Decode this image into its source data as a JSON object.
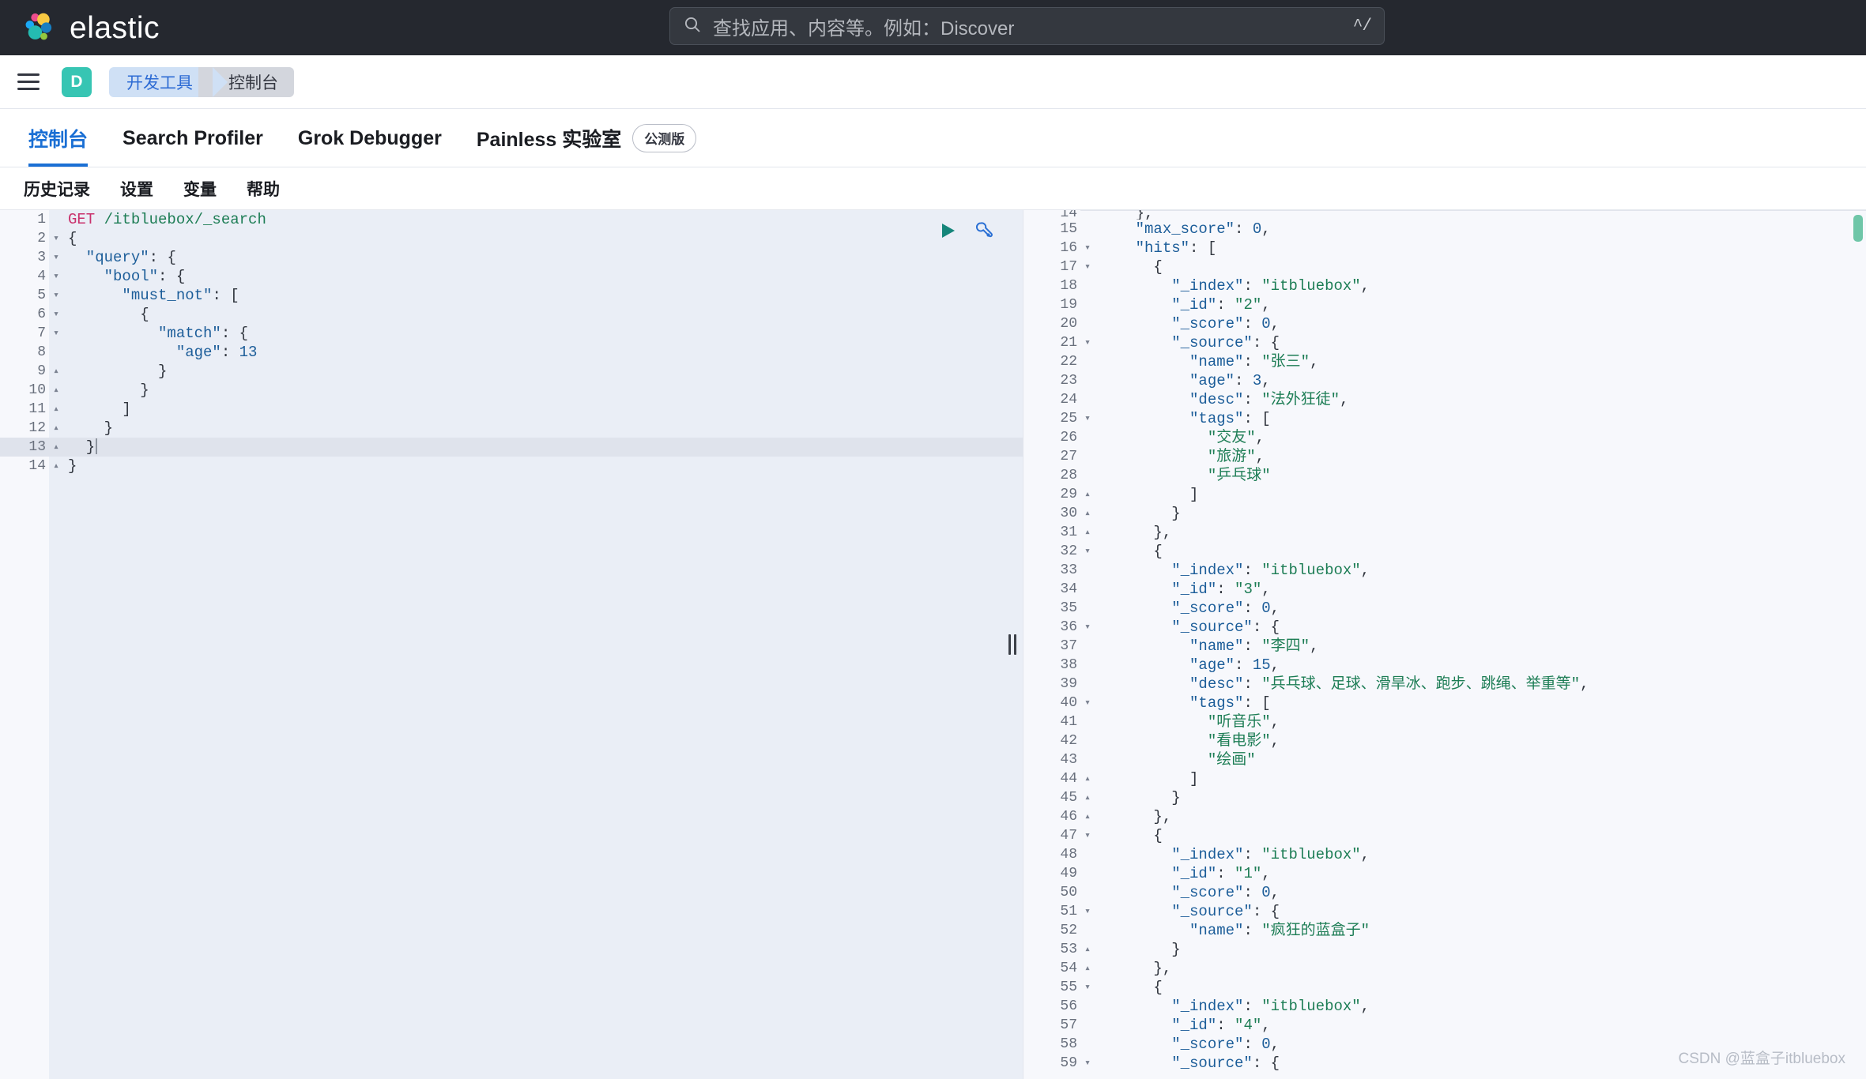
{
  "header": {
    "brand": "elastic",
    "logo_icon": "elastic-logo-icon",
    "search": {
      "icon": "search-icon",
      "placeholder": "查找应用、内容等。例如：Discover",
      "shortcut": "^/"
    }
  },
  "breadcrumb_bar": {
    "menu_icon": "hamburger-menu-icon",
    "space_avatar": "D",
    "crumbs": [
      {
        "label": "开发工具"
      },
      {
        "label": "控制台"
      }
    ]
  },
  "tabs": [
    {
      "label": "控制台",
      "active": true
    },
    {
      "label": "Search Profiler",
      "active": false
    },
    {
      "label": "Grok Debugger",
      "active": false
    },
    {
      "label": "Painless 实验室",
      "active": false,
      "badge": "公测版"
    }
  ],
  "console_menu": [
    {
      "label": "历史记录"
    },
    {
      "label": "设置"
    },
    {
      "label": "变量"
    },
    {
      "label": "帮助"
    }
  ],
  "editor_actions": {
    "play": "play-icon",
    "wrench": "wrench-icon"
  },
  "colors": {
    "accent_blue": "#1a6fd4",
    "brand_teal": "#37c5b3",
    "method": "#c9316c",
    "string": "#1d7d55",
    "key": "#1c5d99",
    "scroll_indicator": "#6fc6a8"
  },
  "request_editor": {
    "active_line": 13,
    "lines": [
      {
        "n": 1,
        "fold": "",
        "indent": 0,
        "tokens": [
          {
            "t": "GET ",
            "c": "t-method"
          },
          {
            "t": "/itbluebox/_search",
            "c": "t-url"
          }
        ]
      },
      {
        "n": 2,
        "fold": "▾",
        "indent": 0,
        "tokens": [
          {
            "t": "{",
            "c": "t-brace"
          }
        ]
      },
      {
        "n": 3,
        "fold": "▾",
        "indent": 1,
        "tokens": [
          {
            "t": "  \"query\"",
            "c": "t-key"
          },
          {
            "t": ": ",
            "c": "t-punc"
          },
          {
            "t": "{",
            "c": "t-brace"
          }
        ]
      },
      {
        "n": 4,
        "fold": "▾",
        "indent": 2,
        "tokens": [
          {
            "t": "    \"bool\"",
            "c": "t-key"
          },
          {
            "t": ": ",
            "c": "t-punc"
          },
          {
            "t": "{",
            "c": "t-brace"
          }
        ]
      },
      {
        "n": 5,
        "fold": "▾",
        "indent": 3,
        "tokens": [
          {
            "t": "      \"must_not\"",
            "c": "t-key"
          },
          {
            "t": ": ",
            "c": "t-punc"
          },
          {
            "t": "[",
            "c": "t-brace"
          }
        ]
      },
      {
        "n": 6,
        "fold": "▾",
        "indent": 4,
        "tokens": [
          {
            "t": "        {",
            "c": "t-brace"
          }
        ]
      },
      {
        "n": 7,
        "fold": "▾",
        "indent": 5,
        "tokens": [
          {
            "t": "          \"match\"",
            "c": "t-key"
          },
          {
            "t": ": ",
            "c": "t-punc"
          },
          {
            "t": "{",
            "c": "t-brace"
          }
        ]
      },
      {
        "n": 8,
        "fold": "",
        "indent": 6,
        "tokens": [
          {
            "t": "            \"age\"",
            "c": "t-key"
          },
          {
            "t": ": ",
            "c": "t-punc"
          },
          {
            "t": "13",
            "c": "t-num"
          }
        ]
      },
      {
        "n": 9,
        "fold": "▴",
        "indent": 5,
        "tokens": [
          {
            "t": "          }",
            "c": "t-brace"
          }
        ]
      },
      {
        "n": 10,
        "fold": "▴",
        "indent": 4,
        "tokens": [
          {
            "t": "        }",
            "c": "t-brace"
          }
        ]
      },
      {
        "n": 11,
        "fold": "▴",
        "indent": 3,
        "tokens": [
          {
            "t": "      ]",
            "c": "t-brace"
          }
        ]
      },
      {
        "n": 12,
        "fold": "▴",
        "indent": 2,
        "tokens": [
          {
            "t": "    }",
            "c": "t-brace"
          }
        ]
      },
      {
        "n": 13,
        "fold": "▴",
        "indent": 1,
        "tokens": [
          {
            "t": "  }",
            "c": "t-brace"
          }
        ]
      },
      {
        "n": 14,
        "fold": "▴",
        "indent": 0,
        "tokens": [
          {
            "t": "}",
            "c": "t-brace"
          }
        ]
      }
    ]
  },
  "response_viewer": {
    "lines": [
      {
        "n": "14",
        "fold": "",
        "clipped": true,
        "tokens": [
          {
            "t": "    },",
            "c": "t-brace"
          }
        ]
      },
      {
        "n": "15",
        "fold": "",
        "tokens": [
          {
            "t": "    \"max_score\"",
            "c": "t-key"
          },
          {
            "t": ": ",
            "c": "t-punc"
          },
          {
            "t": "0",
            "c": "t-num"
          },
          {
            "t": ",",
            "c": "t-punc"
          }
        ]
      },
      {
        "n": "16",
        "fold": "▾",
        "tokens": [
          {
            "t": "    \"hits\"",
            "c": "t-key"
          },
          {
            "t": ": ",
            "c": "t-punc"
          },
          {
            "t": "[",
            "c": "t-brace"
          }
        ]
      },
      {
        "n": "17",
        "fold": "▾",
        "tokens": [
          {
            "t": "      {",
            "c": "t-brace"
          }
        ]
      },
      {
        "n": "18",
        "fold": "",
        "tokens": [
          {
            "t": "        \"_index\"",
            "c": "t-key"
          },
          {
            "t": ": ",
            "c": "t-punc"
          },
          {
            "t": "\"itbluebox\"",
            "c": "t-str"
          },
          {
            "t": ",",
            "c": "t-punc"
          }
        ]
      },
      {
        "n": "19",
        "fold": "",
        "tokens": [
          {
            "t": "        \"_id\"",
            "c": "t-key"
          },
          {
            "t": ": ",
            "c": "t-punc"
          },
          {
            "t": "\"2\"",
            "c": "t-str"
          },
          {
            "t": ",",
            "c": "t-punc"
          }
        ]
      },
      {
        "n": "20",
        "fold": "",
        "tokens": [
          {
            "t": "        \"_score\"",
            "c": "t-key"
          },
          {
            "t": ": ",
            "c": "t-punc"
          },
          {
            "t": "0",
            "c": "t-num"
          },
          {
            "t": ",",
            "c": "t-punc"
          }
        ]
      },
      {
        "n": "21",
        "fold": "▾",
        "tokens": [
          {
            "t": "        \"_source\"",
            "c": "t-key"
          },
          {
            "t": ": ",
            "c": "t-punc"
          },
          {
            "t": "{",
            "c": "t-brace"
          }
        ]
      },
      {
        "n": "22",
        "fold": "",
        "tokens": [
          {
            "t": "          \"name\"",
            "c": "t-key"
          },
          {
            "t": ": ",
            "c": "t-punc"
          },
          {
            "t": "\"张三\"",
            "c": "t-str"
          },
          {
            "t": ",",
            "c": "t-punc"
          }
        ]
      },
      {
        "n": "23",
        "fold": "",
        "tokens": [
          {
            "t": "          \"age\"",
            "c": "t-key"
          },
          {
            "t": ": ",
            "c": "t-punc"
          },
          {
            "t": "3",
            "c": "t-num"
          },
          {
            "t": ",",
            "c": "t-punc"
          }
        ]
      },
      {
        "n": "24",
        "fold": "",
        "tokens": [
          {
            "t": "          \"desc\"",
            "c": "t-key"
          },
          {
            "t": ": ",
            "c": "t-punc"
          },
          {
            "t": "\"法外狂徒\"",
            "c": "t-str"
          },
          {
            "t": ",",
            "c": "t-punc"
          }
        ]
      },
      {
        "n": "25",
        "fold": "▾",
        "tokens": [
          {
            "t": "          \"tags\"",
            "c": "t-key"
          },
          {
            "t": ": ",
            "c": "t-punc"
          },
          {
            "t": "[",
            "c": "t-brace"
          }
        ]
      },
      {
        "n": "26",
        "fold": "",
        "tokens": [
          {
            "t": "            \"交友\"",
            "c": "t-str"
          },
          {
            "t": ",",
            "c": "t-punc"
          }
        ]
      },
      {
        "n": "27",
        "fold": "",
        "tokens": [
          {
            "t": "            \"旅游\"",
            "c": "t-str"
          },
          {
            "t": ",",
            "c": "t-punc"
          }
        ]
      },
      {
        "n": "28",
        "fold": "",
        "tokens": [
          {
            "t": "            \"乒乓球\"",
            "c": "t-str"
          }
        ]
      },
      {
        "n": "29",
        "fold": "▴",
        "tokens": [
          {
            "t": "          ]",
            "c": "t-brace"
          }
        ]
      },
      {
        "n": "30",
        "fold": "▴",
        "tokens": [
          {
            "t": "        }",
            "c": "t-brace"
          }
        ]
      },
      {
        "n": "31",
        "fold": "▴",
        "tokens": [
          {
            "t": "      },",
            "c": "t-brace"
          }
        ]
      },
      {
        "n": "32",
        "fold": "▾",
        "tokens": [
          {
            "t": "      {",
            "c": "t-brace"
          }
        ]
      },
      {
        "n": "33",
        "fold": "",
        "tokens": [
          {
            "t": "        \"_index\"",
            "c": "t-key"
          },
          {
            "t": ": ",
            "c": "t-punc"
          },
          {
            "t": "\"itbluebox\"",
            "c": "t-str"
          },
          {
            "t": ",",
            "c": "t-punc"
          }
        ]
      },
      {
        "n": "34",
        "fold": "",
        "tokens": [
          {
            "t": "        \"_id\"",
            "c": "t-key"
          },
          {
            "t": ": ",
            "c": "t-punc"
          },
          {
            "t": "\"3\"",
            "c": "t-str"
          },
          {
            "t": ",",
            "c": "t-punc"
          }
        ]
      },
      {
        "n": "35",
        "fold": "",
        "tokens": [
          {
            "t": "        \"_score\"",
            "c": "t-key"
          },
          {
            "t": ": ",
            "c": "t-punc"
          },
          {
            "t": "0",
            "c": "t-num"
          },
          {
            "t": ",",
            "c": "t-punc"
          }
        ]
      },
      {
        "n": "36",
        "fold": "▾",
        "tokens": [
          {
            "t": "        \"_source\"",
            "c": "t-key"
          },
          {
            "t": ": ",
            "c": "t-punc"
          },
          {
            "t": "{",
            "c": "t-brace"
          }
        ]
      },
      {
        "n": "37",
        "fold": "",
        "tokens": [
          {
            "t": "          \"name\"",
            "c": "t-key"
          },
          {
            "t": ": ",
            "c": "t-punc"
          },
          {
            "t": "\"李四\"",
            "c": "t-str"
          },
          {
            "t": ",",
            "c": "t-punc"
          }
        ]
      },
      {
        "n": "38",
        "fold": "",
        "tokens": [
          {
            "t": "          \"age\"",
            "c": "t-key"
          },
          {
            "t": ": ",
            "c": "t-punc"
          },
          {
            "t": "15",
            "c": "t-num"
          },
          {
            "t": ",",
            "c": "t-punc"
          }
        ]
      },
      {
        "n": "39",
        "fold": "",
        "tokens": [
          {
            "t": "          \"desc\"",
            "c": "t-key"
          },
          {
            "t": ": ",
            "c": "t-punc"
          },
          {
            "t": "\"兵乓球、足球、滑旱冰、跑步、跳绳、举重等\"",
            "c": "t-str"
          },
          {
            "t": ",",
            "c": "t-punc"
          }
        ]
      },
      {
        "n": "40",
        "fold": "▾",
        "tokens": [
          {
            "t": "          \"tags\"",
            "c": "t-key"
          },
          {
            "t": ": ",
            "c": "t-punc"
          },
          {
            "t": "[",
            "c": "t-brace"
          }
        ]
      },
      {
        "n": "41",
        "fold": "",
        "tokens": [
          {
            "t": "            \"听音乐\"",
            "c": "t-str"
          },
          {
            "t": ",",
            "c": "t-punc"
          }
        ]
      },
      {
        "n": "42",
        "fold": "",
        "tokens": [
          {
            "t": "            \"看电影\"",
            "c": "t-str"
          },
          {
            "t": ",",
            "c": "t-punc"
          }
        ]
      },
      {
        "n": "43",
        "fold": "",
        "tokens": [
          {
            "t": "            \"绘画\"",
            "c": "t-str"
          }
        ]
      },
      {
        "n": "44",
        "fold": "▴",
        "tokens": [
          {
            "t": "          ]",
            "c": "t-brace"
          }
        ]
      },
      {
        "n": "45",
        "fold": "▴",
        "tokens": [
          {
            "t": "        }",
            "c": "t-brace"
          }
        ]
      },
      {
        "n": "46",
        "fold": "▴",
        "tokens": [
          {
            "t": "      },",
            "c": "t-brace"
          }
        ]
      },
      {
        "n": "47",
        "fold": "▾",
        "tokens": [
          {
            "t": "      {",
            "c": "t-brace"
          }
        ]
      },
      {
        "n": "48",
        "fold": "",
        "tokens": [
          {
            "t": "        \"_index\"",
            "c": "t-key"
          },
          {
            "t": ": ",
            "c": "t-punc"
          },
          {
            "t": "\"itbluebox\"",
            "c": "t-str"
          },
          {
            "t": ",",
            "c": "t-punc"
          }
        ]
      },
      {
        "n": "49",
        "fold": "",
        "tokens": [
          {
            "t": "        \"_id\"",
            "c": "t-key"
          },
          {
            "t": ": ",
            "c": "t-punc"
          },
          {
            "t": "\"1\"",
            "c": "t-str"
          },
          {
            "t": ",",
            "c": "t-punc"
          }
        ]
      },
      {
        "n": "50",
        "fold": "",
        "tokens": [
          {
            "t": "        \"_score\"",
            "c": "t-key"
          },
          {
            "t": ": ",
            "c": "t-punc"
          },
          {
            "t": "0",
            "c": "t-num"
          },
          {
            "t": ",",
            "c": "t-punc"
          }
        ]
      },
      {
        "n": "51",
        "fold": "▾",
        "tokens": [
          {
            "t": "        \"_source\"",
            "c": "t-key"
          },
          {
            "t": ": ",
            "c": "t-punc"
          },
          {
            "t": "{",
            "c": "t-brace"
          }
        ]
      },
      {
        "n": "52",
        "fold": "",
        "tokens": [
          {
            "t": "          \"name\"",
            "c": "t-key"
          },
          {
            "t": ": ",
            "c": "t-punc"
          },
          {
            "t": "\"疯狂的蓝盒子\"",
            "c": "t-str"
          }
        ]
      },
      {
        "n": "53",
        "fold": "▴",
        "tokens": [
          {
            "t": "        }",
            "c": "t-brace"
          }
        ]
      },
      {
        "n": "54",
        "fold": "▴",
        "tokens": [
          {
            "t": "      },",
            "c": "t-brace"
          }
        ]
      },
      {
        "n": "55",
        "fold": "▾",
        "tokens": [
          {
            "t": "      {",
            "c": "t-brace"
          }
        ]
      },
      {
        "n": "56",
        "fold": "",
        "tokens": [
          {
            "t": "        \"_index\"",
            "c": "t-key"
          },
          {
            "t": ": ",
            "c": "t-punc"
          },
          {
            "t": "\"itbluebox\"",
            "c": "t-str"
          },
          {
            "t": ",",
            "c": "t-punc"
          }
        ]
      },
      {
        "n": "57",
        "fold": "",
        "tokens": [
          {
            "t": "        \"_id\"",
            "c": "t-key"
          },
          {
            "t": ": ",
            "c": "t-punc"
          },
          {
            "t": "\"4\"",
            "c": "t-str"
          },
          {
            "t": ",",
            "c": "t-punc"
          }
        ]
      },
      {
        "n": "58",
        "fold": "",
        "tokens": [
          {
            "t": "        \"_score\"",
            "c": "t-key"
          },
          {
            "t": ": ",
            "c": "t-punc"
          },
          {
            "t": "0",
            "c": "t-num"
          },
          {
            "t": ",",
            "c": "t-punc"
          }
        ]
      },
      {
        "n": "59",
        "fold": "▾",
        "tokens": [
          {
            "t": "        \"_source\"",
            "c": "t-key"
          },
          {
            "t": ": ",
            "c": "t-punc"
          },
          {
            "t": "{",
            "c": "t-brace"
          }
        ]
      }
    ]
  },
  "watermark": "CSDN @蓝盒子itbluebox"
}
